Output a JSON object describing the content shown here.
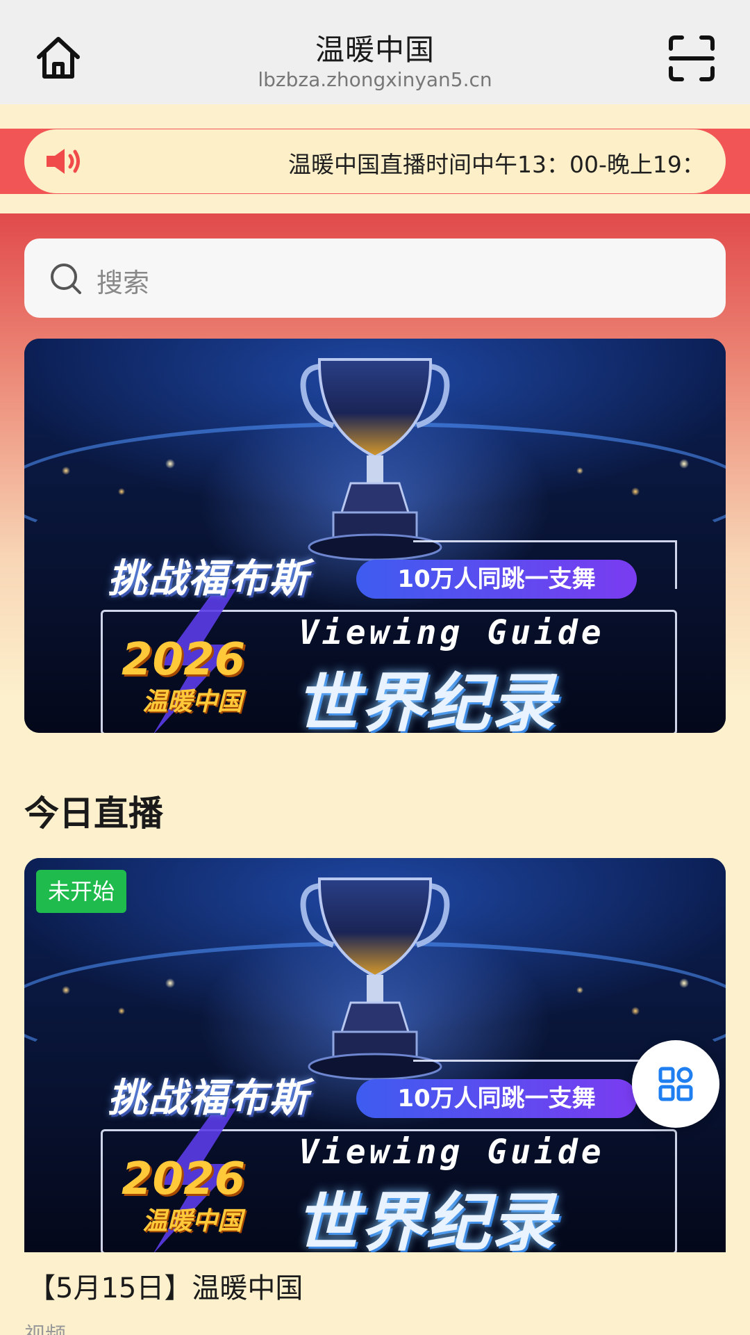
{
  "header": {
    "title": "温暖中国",
    "url": "lbzbza.zhongxinyan5.cn"
  },
  "notice": {
    "text": "温暖中国直播时间中午13：00-晚上19："
  },
  "search": {
    "placeholder": "搜索"
  },
  "banner": {
    "challenge": "挑战福布斯",
    "pill": "10万人同跳一支舞",
    "viewing_guide": "Viewing Guide",
    "world_record": "世界纪录",
    "year": "2026",
    "brand": "温暖中国"
  },
  "live_section": {
    "title": "今日直播",
    "items": [
      {
        "status": "未开始",
        "status_color": "#1fbb4d",
        "title": "【5月15日】温暖中国",
        "type": "视频"
      }
    ]
  },
  "icons": {
    "home": "home-icon",
    "scan": "scan-icon",
    "speaker": "speaker-icon",
    "search": "search-icon",
    "apps": "grid-apps-icon"
  },
  "colors": {
    "accent_red": "#f25555",
    "page_bg": "#fdf1cd",
    "apps_blue": "#1f7ff0"
  }
}
